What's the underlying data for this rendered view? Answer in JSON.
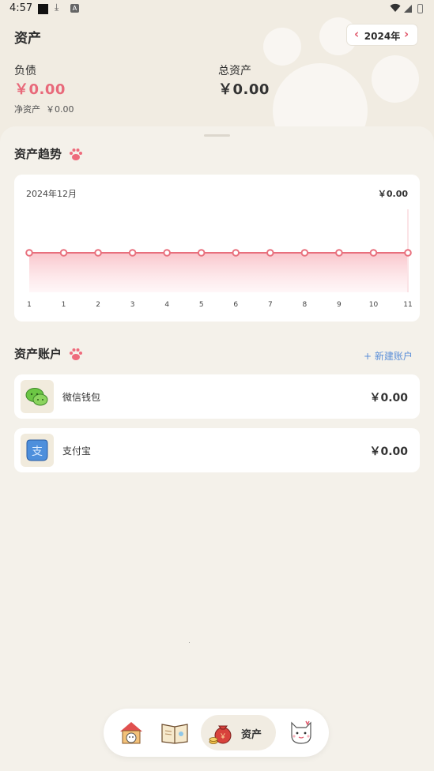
{
  "status_bar": {
    "time": "4:57",
    "icons": [
      "notification-square-icon",
      "download-icon",
      "a-icon",
      "wifi-icon",
      "signal-icon",
      "battery-icon"
    ]
  },
  "header": {
    "title": "资产",
    "year": "2024年",
    "prev_icon": "‹",
    "next_icon": "›"
  },
  "summary": {
    "debt_label": "负债",
    "debt_value": "￥0.00",
    "total_label": "总资产",
    "total_value": "￥0.00",
    "net_label": "净资产",
    "net_value": "￥0.00"
  },
  "trend": {
    "title": "资产趋势",
    "date": "2024年12月",
    "total": "￥0.00"
  },
  "chart_data": {
    "type": "area",
    "categories": [
      "1",
      "1",
      "2",
      "3",
      "4",
      "5",
      "6",
      "7",
      "8",
      "9",
      "10",
      "11"
    ],
    "values": [
      0,
      0,
      0,
      0,
      0,
      0,
      0,
      0,
      0,
      0,
      0,
      0
    ],
    "title": "",
    "xlabel": "",
    "ylabel": "",
    "colors": {
      "line": "#e8707d",
      "fill_top": "#f9c3c9"
    }
  },
  "accounts": {
    "title": "资产账户",
    "add_label": "+ 新建账户",
    "items": [
      {
        "name": "微信钱包",
        "value": "￥0.00",
        "icon": "wechat-icon"
      },
      {
        "name": "支付宝",
        "value": "￥0.00",
        "icon": "alipay-icon"
      }
    ]
  },
  "tabbar": {
    "items": [
      {
        "icon": "cat-house-icon"
      },
      {
        "icon": "notebook-icon"
      },
      {
        "icon": "money-bag-icon",
        "label": "资产",
        "active": true
      },
      {
        "icon": "cat-profile-icon"
      }
    ]
  },
  "colors": {
    "accent": "#e8697a",
    "link": "#5b8fd8",
    "background": "#f4f1ea"
  }
}
